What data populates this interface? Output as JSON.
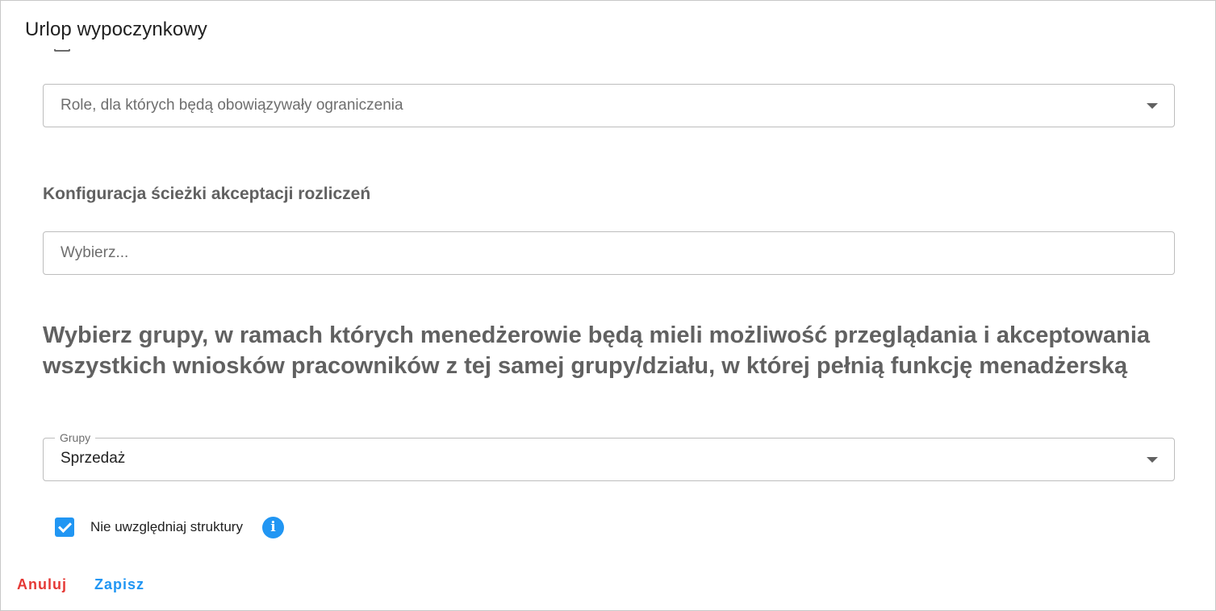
{
  "dialog": {
    "title": "Urlop wypoczynkowy"
  },
  "roles_select": {
    "placeholder": "Role, dla których będą obowiązywały ograniczenia"
  },
  "acceptance_path": {
    "heading": "Konfiguracja ścieżki akceptacji rozliczeń",
    "placeholder": "Wybierz..."
  },
  "groups_section": {
    "heading": "Wybierz grupy, w ramach których menedżerowie będą mieli możliwość przeglądania i akceptowania wszystkich wniosków pracowników z tej samej grupy/działu, w której pełnią funkcję menadżerską",
    "field_label": "Grupy",
    "selected_value": "Sprzedaż"
  },
  "structure_checkbox": {
    "label": "Nie uwzględniaj struktury",
    "checked": true,
    "icon": "info-icon"
  },
  "footer": {
    "cancel_label": "Anuluj",
    "save_label": "Zapisz"
  },
  "colors": {
    "accent": "#2196f3",
    "danger": "#e53935"
  }
}
